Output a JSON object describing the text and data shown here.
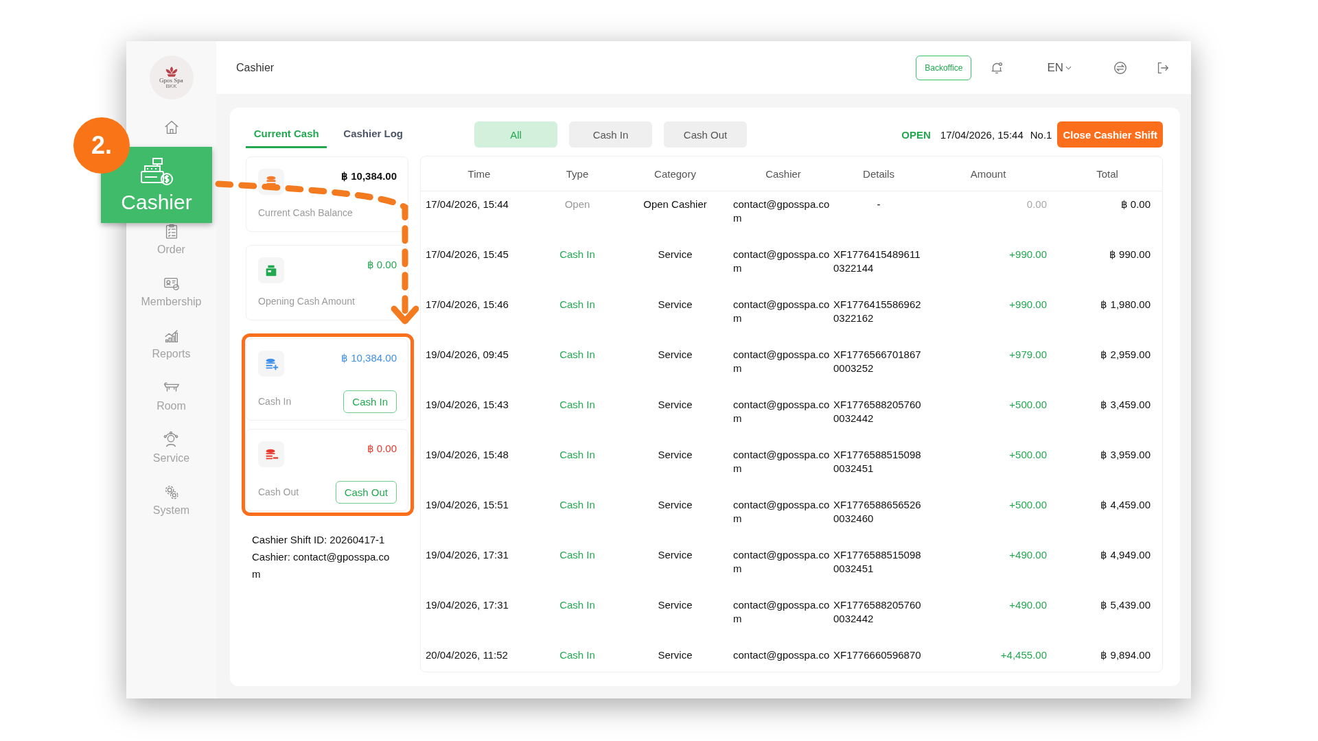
{
  "callout": {
    "number": "2.",
    "label": "Cashier"
  },
  "sidebar": {
    "logo": {
      "name": "Gpos Spa",
      "sub": "BKK"
    },
    "items": [
      {
        "kind": "home"
      },
      {
        "kind": "hidden"
      },
      {
        "kind": "order",
        "label": "Order"
      },
      {
        "kind": "membership",
        "label": "Membership"
      },
      {
        "kind": "reports",
        "label": "Reports"
      },
      {
        "kind": "room",
        "label": "Room"
      },
      {
        "kind": "service",
        "label": "Service"
      },
      {
        "kind": "system",
        "label": "System"
      }
    ]
  },
  "header": {
    "title": "Cashier",
    "backoffice": "Backoffice",
    "language": "EN"
  },
  "tabs": [
    {
      "label": "Current Cash",
      "selected": true
    },
    {
      "label": "Cashier Log",
      "selected": false
    }
  ],
  "filters": [
    {
      "label": "All",
      "selected": true
    },
    {
      "label": "Cash In",
      "selected": false
    },
    {
      "label": "Cash Out",
      "selected": false
    }
  ],
  "shift": {
    "status": "OPEN",
    "opened": "17/04/2026, 15:44",
    "number": "No.1",
    "close_button": "Close Cashier Shift"
  },
  "cards": [
    {
      "kind": "balance",
      "amount": "฿ 10,384.00",
      "label": "Current Cash Balance"
    },
    {
      "kind": "opening",
      "amount": "฿ 0.00",
      "label": "Opening Cash Amount"
    },
    {
      "kind": "cash_in",
      "amount": "฿ 10,384.00",
      "label": "Cash In",
      "button": "Cash In"
    },
    {
      "kind": "cash_out",
      "amount": "฿ 0.00",
      "label": "Cash Out",
      "button": "Cash Out"
    }
  ],
  "shift_info": [
    "Cashier Shift ID: 20260417-1",
    "Cashier: contact@gposspa.com"
  ],
  "table": {
    "columns": [
      "Time",
      "Type",
      "Category",
      "Cashier",
      "Details",
      "Amount",
      "Total"
    ],
    "rows": [
      {
        "kind": "open",
        "time": "17/04/2026, 15:44",
        "type": "Open",
        "category": "Open Cashier",
        "cashier": "contact@gposspa.com",
        "details": "-",
        "amount": "0.00",
        "total": "฿ 0.00"
      },
      {
        "kind": "cash_in",
        "time": "17/04/2026, 15:45",
        "type": "Cash In",
        "category": "Service",
        "cashier": "contact@gposspa.com",
        "details": "XF17764154896110322144",
        "amount": "+990.00",
        "total": "฿ 990.00"
      },
      {
        "kind": "cash_in",
        "time": "17/04/2026, 15:46",
        "type": "Cash In",
        "category": "Service",
        "cashier": "contact@gposspa.com",
        "details": "XF17764155869620322162",
        "amount": "+990.00",
        "total": "฿ 1,980.00"
      },
      {
        "kind": "cash_in",
        "time": "19/04/2026, 09:45",
        "type": "Cash In",
        "category": "Service",
        "cashier": "contact@gposspa.com",
        "details": "XF17765667018670003252",
        "amount": "+979.00",
        "total": "฿ 2,959.00"
      },
      {
        "kind": "cash_in",
        "time": "19/04/2026, 15:43",
        "type": "Cash In",
        "category": "Service",
        "cashier": "contact@gposspa.com",
        "details": "XF17765882057600032442",
        "amount": "+500.00",
        "total": "฿ 3,459.00"
      },
      {
        "kind": "cash_in",
        "time": "19/04/2026, 15:48",
        "type": "Cash In",
        "category": "Service",
        "cashier": "contact@gposspa.com",
        "details": "XF17765885150980032451",
        "amount": "+500.00",
        "total": "฿ 3,959.00"
      },
      {
        "kind": "cash_in",
        "time": "19/04/2026, 15:51",
        "type": "Cash In",
        "category": "Service",
        "cashier": "contact@gposspa.com",
        "details": "XF17765886565260032460",
        "amount": "+500.00",
        "total": "฿ 4,459.00"
      },
      {
        "kind": "cash_in",
        "time": "19/04/2026, 17:31",
        "type": "Cash In",
        "category": "Service",
        "cashier": "contact@gposspa.com",
        "details": "XF17765885150980032451",
        "amount": "+490.00",
        "total": "฿ 4,949.00"
      },
      {
        "kind": "cash_in",
        "time": "19/04/2026, 17:31",
        "type": "Cash In",
        "category": "Service",
        "cashier": "contact@gposspa.com",
        "details": "XF17765882057600032442",
        "amount": "+490.00",
        "total": "฿ 5,439.00"
      },
      {
        "kind": "cash_in",
        "time": "20/04/2026, 11:52",
        "type": "Cash In",
        "category": "Service",
        "cashier": "contact@gposspa.co",
        "details": "XF1776660596870",
        "amount": "+4,455.00",
        "total": "฿ 9,894.00"
      }
    ]
  }
}
